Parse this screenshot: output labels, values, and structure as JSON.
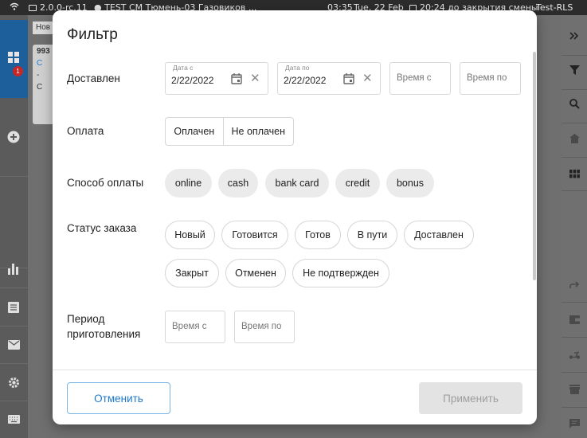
{
  "status_bar": {
    "version": "2.0.0-rc.11",
    "location": "TEST CM Тюмень-03 Газовиков ...",
    "time": "03:35",
    "date": "Tue, 22 Feb",
    "shift": "20:24 до закрытия смены",
    "network": "Test-RLS"
  },
  "sidebar": {
    "badge_count": "1"
  },
  "background": {
    "tab_label": "Нов",
    "card_number": "993",
    "card_line1": "C",
    "card_line2": "-",
    "card_line3": "C"
  },
  "modal": {
    "title": "Фильтр",
    "delivered": {
      "label": "Доставлен",
      "date_from_label": "Дата с",
      "date_from_value": "2/22/2022",
      "date_to_label": "Дата по",
      "date_to_value": "2/22/2022",
      "time_from_placeholder": "Время с",
      "time_to_placeholder": "Время по"
    },
    "payment": {
      "label": "Оплата",
      "options": [
        "Оплачен",
        "Не оплачен"
      ]
    },
    "payment_method": {
      "label": "Способ оплаты",
      "options": [
        "online",
        "cash",
        "bank card",
        "credit",
        "bonus"
      ]
    },
    "order_status": {
      "label": "Статус заказа",
      "options": [
        "Новый",
        "Готовится",
        "Готов",
        "В пути",
        "Доставлен",
        "Закрыт",
        "Отменен",
        "Не подтвержден"
      ]
    },
    "cooking_period": {
      "label_line1": "Период",
      "label_line2": "приготовления",
      "time_from_placeholder": "Время с",
      "time_to_placeholder": "Время по"
    },
    "footer": {
      "cancel_label": "Отменить",
      "apply_label": "Применить"
    }
  }
}
